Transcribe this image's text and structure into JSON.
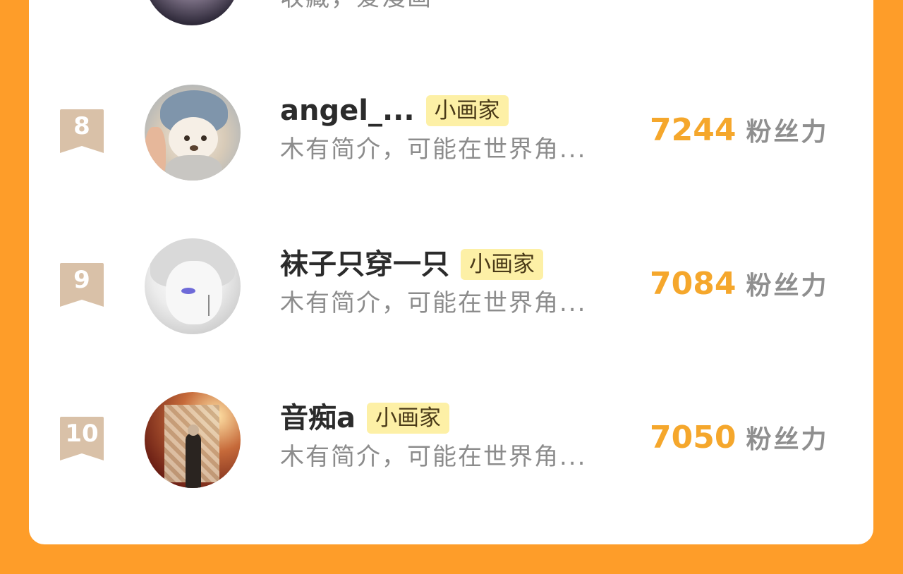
{
  "partial_row": {
    "desc": "收藏，爱漫画"
  },
  "rows": [
    {
      "rank": "8",
      "name": "angel_...",
      "badge": "小画家",
      "desc": "木有简介，可能在世界角...",
      "fans": "7244",
      "fans_label": "粉丝力",
      "avatar": "teddy-bear-avatar"
    },
    {
      "rank": "9",
      "name": "袜子只穿一只",
      "badge": "小画家",
      "desc": "木有简介，可能在世界角...",
      "fans": "7084",
      "fans_label": "粉丝力",
      "avatar": "anime-character-avatar"
    },
    {
      "rank": "10",
      "name": "音痴a",
      "badge": "小画家",
      "desc": "木有简介，可能在世界角...",
      "fans": "7050",
      "fans_label": "粉丝力",
      "avatar": "person-in-room-avatar"
    }
  ],
  "colors": {
    "background": "#fe9d29",
    "card": "#ffffff",
    "fans_number": "#f5a72c",
    "badge_bg": "#fdf0a6",
    "rank_ribbon": "#d9c1a8"
  }
}
